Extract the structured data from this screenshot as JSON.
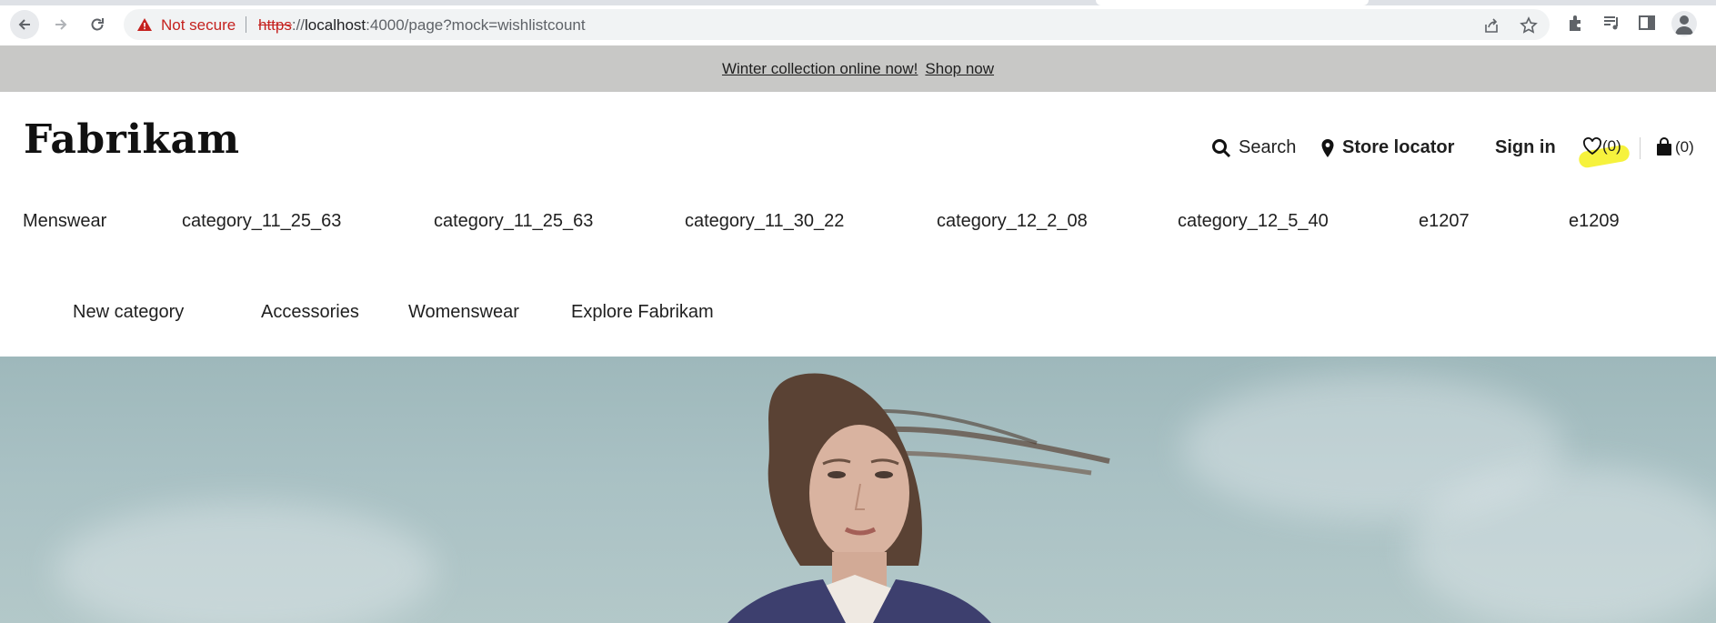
{
  "browser": {
    "security_label": "Not secure",
    "url_scheme": "https",
    "url_sep": "://",
    "url_host": "localhost",
    "url_rest": ":4000/page?mock=wishlistcount",
    "icons": [
      "back-icon",
      "forward-icon",
      "reload-icon",
      "warning-icon",
      "share-icon",
      "star-icon",
      "extensions-icon",
      "media-icon",
      "side-panel-icon",
      "profile-icon"
    ]
  },
  "promo": {
    "text": "Winter collection online now!",
    "link": "Shop now"
  },
  "header": {
    "logo": "Fabrikam",
    "search_label": "Search",
    "store_label": "Store locator",
    "signin_label": "Sign in",
    "wishlist_count": "(0)",
    "bag_count": "(0)",
    "highlight_color": "#f5f128"
  },
  "nav": {
    "row1": [
      "Menswear",
      "category_11_25_63",
      "category_11_25_63",
      "category_11_30_22",
      "category_12_2_08",
      "category_12_5_40",
      "e1207",
      "e1209"
    ],
    "row2": [
      "New category",
      "Accessories",
      "Womenswear",
      "Explore Fabrikam"
    ]
  },
  "hero": {
    "image": "woman-windswept-hair-photo",
    "sky_color": "#a9c1c4"
  }
}
